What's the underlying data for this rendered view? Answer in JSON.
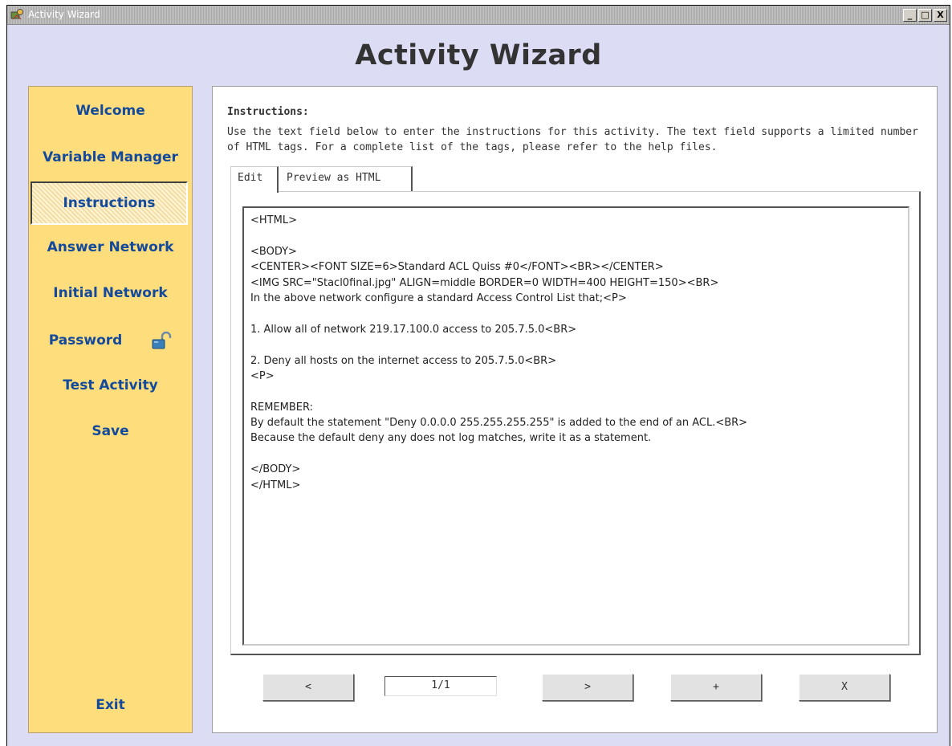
{
  "window": {
    "title": "Activity Wizard",
    "controls": [
      "_",
      "□",
      "X"
    ]
  },
  "app": {
    "heading": "Activity Wizard"
  },
  "sidebar": {
    "items": [
      {
        "label": "Welcome"
      },
      {
        "label": "Variable Manager"
      },
      {
        "label": "Instructions",
        "active": true
      },
      {
        "label": "Answer Network"
      },
      {
        "label": "Initial Network"
      },
      {
        "label": "Password",
        "icon": "unlocked-padlock-icon"
      },
      {
        "label": "Test Activity"
      },
      {
        "label": "Save"
      }
    ],
    "exit_label": "Exit"
  },
  "instructions": {
    "heading": "Instructions:",
    "description_line1": "Use the text field below to enter the instructions for this activity. The text field supports a limited number",
    "description_line2": "of HTML tags. For a complete list of the tags, please refer to the help files."
  },
  "tabs": [
    {
      "label": "Edit",
      "selected": true
    },
    {
      "label": "Preview as HTML",
      "selected": false
    }
  ],
  "editor": {
    "lines": [
      "<HTML>",
      "",
      "<BODY>",
      "<CENTER><FONT SIZE=6>Standard ACL Quiss #0</FONT><BR></CENTER>",
      "<IMG SRC=\"Stacl0final.jpg\" ALIGN=middle BORDER=0 WIDTH=400 HEIGHT=150><BR>",
      "In the above network configure a standard Access Control List that;<P>",
      "",
      "1. Allow all of network 219.17.100.0 access to 205.7.5.0<BR>",
      "",
      "2. Deny all hosts on the internet access to 205.7.5.0<BR>",
      "<P>",
      "",
      "REMEMBER:",
      "By default the statement \"Deny 0.0.0.0 255.255.255.255\" is added to the end of an ACL.<BR>",
      "Because the default deny any does not log matches, write it as a statement.",
      "",
      "</BODY>",
      "</HTML>"
    ]
  },
  "pager": {
    "prev_label": "<",
    "page_value": "1/1",
    "next_label": ">",
    "add_label": "+",
    "delete_label": "X"
  },
  "colors": {
    "window_bg": "#dcdcf4",
    "sidebar_bg": "#fedd7c",
    "nav_text": "#134a9c"
  }
}
